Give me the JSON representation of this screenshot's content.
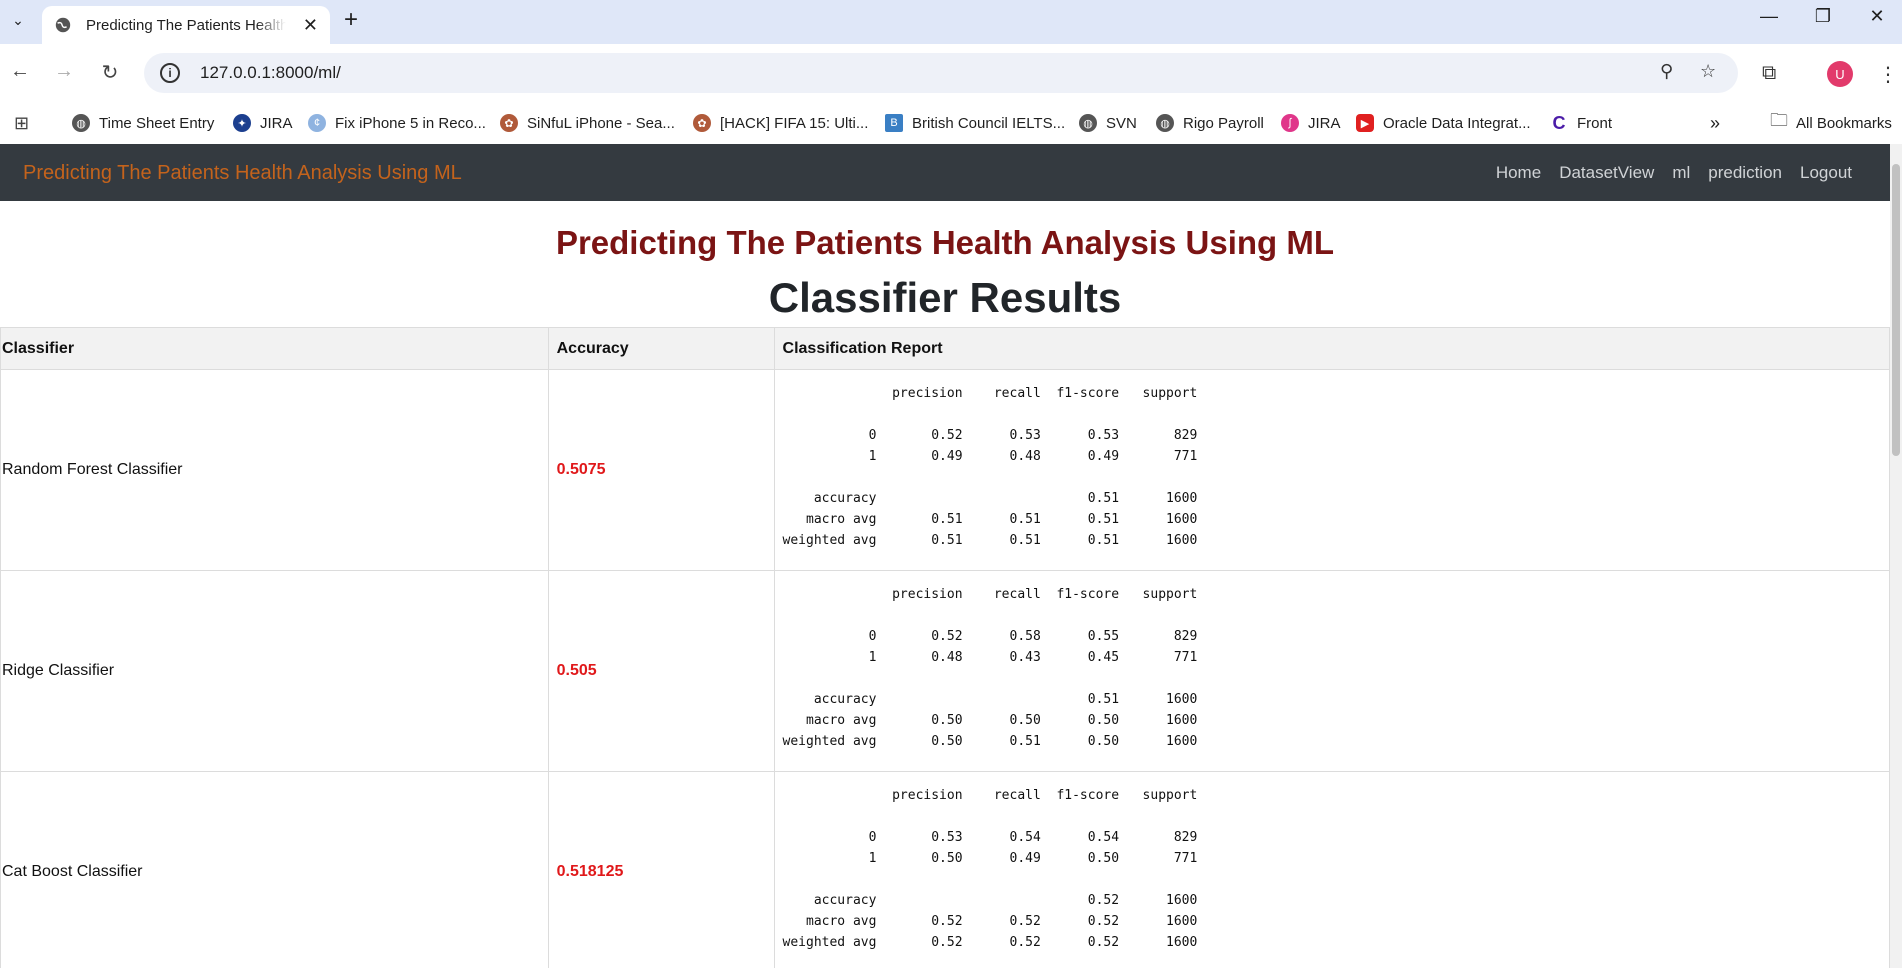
{
  "browser": {
    "tab_title": "Predicting The Patients Health Analysis Using ML",
    "url": "127.0.0.1:8000/ml/",
    "avatar_initial": "U",
    "bookmarks": [
      {
        "label": "Time Sheet Entry",
        "icon": "globe-icon"
      },
      {
        "label": "JIRA",
        "icon": "jira-icon"
      },
      {
        "label": "Fix iPhone 5 in Reco...",
        "icon": "iphone-icon"
      },
      {
        "label": "SiNfuL iPhone - Sea...",
        "icon": "sinful-icon"
      },
      {
        "label": "[HACK] FIFA 15: Ulti...",
        "icon": "fifa-icon"
      },
      {
        "label": "British Council IELTS...",
        "icon": "ielts-icon"
      },
      {
        "label": "SVN",
        "icon": "globe-icon"
      },
      {
        "label": "Rigo Payroll",
        "icon": "globe-icon"
      },
      {
        "label": "JIRA",
        "icon": "jira-pink-icon"
      },
      {
        "label": "Oracle Data Integrat...",
        "icon": "youtube-icon"
      },
      {
        "label": "Front",
        "icon": "front-icon"
      }
    ],
    "all_bookmarks_label": "All Bookmarks"
  },
  "navbar": {
    "brand": "Predicting The Patients Health Analysis Using ML",
    "links": [
      "Home",
      "DatasetView",
      "ml",
      "prediction",
      "Logout"
    ]
  },
  "main": {
    "heading": "Predicting The Patients Health Analysis Using ML",
    "subheading": "Classifier Results",
    "table": {
      "headers": [
        "Classifier",
        "Accuracy",
        "Classification Report"
      ],
      "rows": [
        {
          "classifier": "Random Forest Classifier",
          "accuracy": "0.5075",
          "report": "              precision    recall  f1-score   support\n\n           0       0.52      0.53      0.53       829\n           1       0.49      0.48      0.49       771\n\n    accuracy                           0.51      1600\n   macro avg       0.51      0.51      0.51      1600\nweighted avg       0.51      0.51      0.51      1600"
        },
        {
          "classifier": "Ridge Classifier",
          "accuracy": "0.505",
          "report": "              precision    recall  f1-score   support\n\n           0       0.52      0.58      0.55       829\n           1       0.48      0.43      0.45       771\n\n    accuracy                           0.51      1600\n   macro avg       0.50      0.50      0.50      1600\nweighted avg       0.50      0.51      0.50      1600"
        },
        {
          "classifier": "Cat Boost Classifier",
          "accuracy": "0.518125",
          "report": "              precision    recall  f1-score   support\n\n           0       0.53      0.54      0.54       829\n           1       0.50      0.49      0.50       771\n\n    accuracy                           0.52      1600\n   macro avg       0.52      0.52      0.52      1600\nweighted avg       0.52      0.52      0.52      1600"
        }
      ]
    }
  },
  "colors": {
    "navbar_bg": "#343a40",
    "brand": "#c4631c",
    "heading": "#7b1414",
    "accuracy": "#e0181a"
  }
}
